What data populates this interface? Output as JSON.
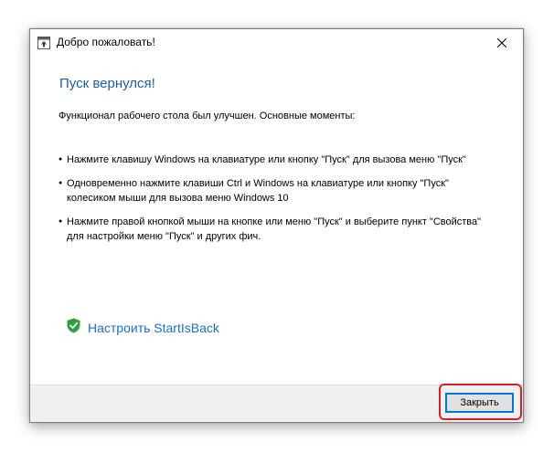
{
  "window": {
    "title": "Добро пожаловать!",
    "app_icon": "arrow-up-window-icon",
    "close_icon": "close-icon"
  },
  "content": {
    "heading": "Пуск вернулся!",
    "intro": "Функционал рабочего стола был улучшен. Основные моменты:",
    "bullet_glyph": "●",
    "bullets": [
      "Нажмите клавишу Windows на клавиатуре или кнопку \"Пуск\" для вызова меню \"Пуск\"",
      "Одновременно нажмите клавиши Ctrl и Windows на клавиатуре или кнопку \"Пуск\" колесиком мыши для вызова меню Windows 10",
      "Нажмите правой кнопкой мыши на кнопке или меню \"Пуск\" и выберите пункт \"Свойства\" для настройки меню \"Пуск\" и других фич."
    ],
    "configure_link": "Настроить StartIsBack",
    "configure_icon": "green-shield-check-icon"
  },
  "footer": {
    "close_button": "Закрыть"
  },
  "colors": {
    "heading": "#1a5ea8",
    "link": "#1a72bb",
    "shield": "#2e9e3e",
    "footer_bg": "#f0f0f0",
    "button_focus": "#0078d7",
    "highlight": "#d4202a"
  }
}
